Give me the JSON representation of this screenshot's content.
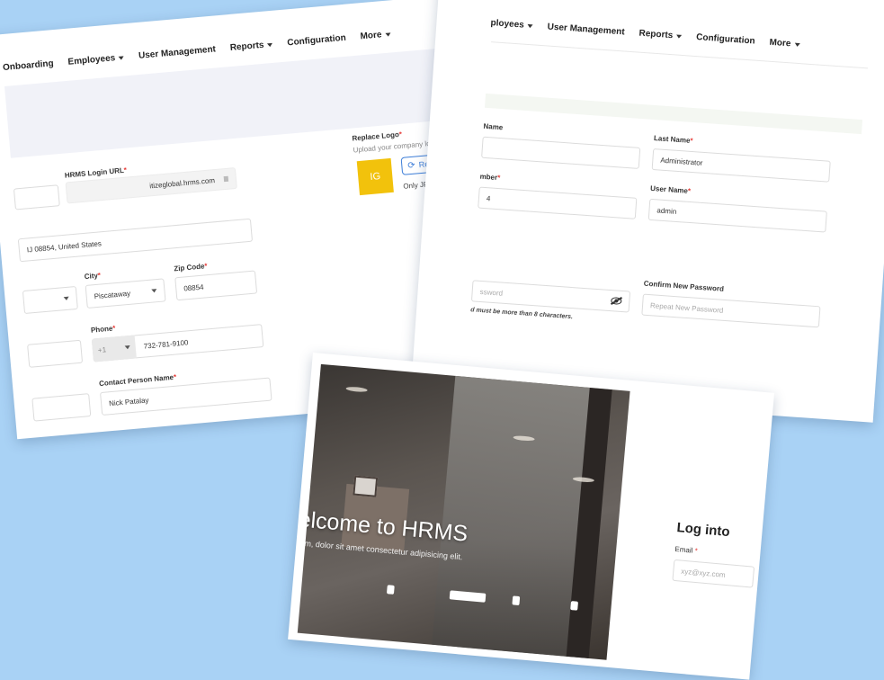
{
  "company_form": {
    "nav": [
      {
        "label": "Onboarding",
        "dropdown": false
      },
      {
        "label": "Employees",
        "dropdown": true
      },
      {
        "label": "User Management",
        "dropdown": false
      },
      {
        "label": "Reports",
        "dropdown": true
      },
      {
        "label": "Configuration",
        "dropdown": false
      },
      {
        "label": "More",
        "dropdown": true
      }
    ],
    "hrms_login_url_label": "HRMS Login URL",
    "hrms_login_url_value": "itizeglobal.hrms.com",
    "replace_logo_label": "Replace Logo",
    "upload_hint": "Upload your company logo",
    "logo_initials": "IG",
    "replace_logo_button": "Replace logo",
    "file_format_hint": "Only JPG and PNG file format s",
    "address_value": "IJ 08854, United States",
    "city_label": "City",
    "city_value": "Piscataway",
    "zip_label": "Zip Code",
    "zip_value": "08854",
    "phone_label": "Phone",
    "phone_prefix": "+1",
    "phone_value": "732-781-9100",
    "contact_label": "Contact Person Name",
    "contact_value": "Nick Patalay",
    "required_mark": "*"
  },
  "user_form": {
    "nav": [
      {
        "label": "ployees",
        "dropdown": true
      },
      {
        "label": "User Management",
        "dropdown": false
      },
      {
        "label": "Reports",
        "dropdown": true
      },
      {
        "label": "Configuration",
        "dropdown": false
      },
      {
        "label": "More",
        "dropdown": true
      }
    ],
    "first_name_label_partial": "Name",
    "last_name_label": "Last Name",
    "last_name_value": "Administrator",
    "number_label_partial": "mber",
    "number_value_partial": "4",
    "user_name_label": "User Name",
    "user_name_value": "admin",
    "new_password_placeholder_partial": "ssword",
    "confirm_password_label": "Confirm New Password",
    "confirm_password_placeholder": "Repeat New Password",
    "password_hint_partial": "d must be more than 8 characters."
  },
  "login": {
    "welcome_partial": "elcome to HRMS",
    "lorem_partial": "um, dolor sit amet consectetur adipisicing elit.",
    "title": "Log into",
    "email_label": "Email",
    "email_placeholder_partial": "xyz@xyz.com",
    "required_mark": "*"
  },
  "colors": {
    "background": "#a9d2f5",
    "accent": "#3d7ed8",
    "logo": "#f2c20c",
    "required": "#e53935"
  }
}
